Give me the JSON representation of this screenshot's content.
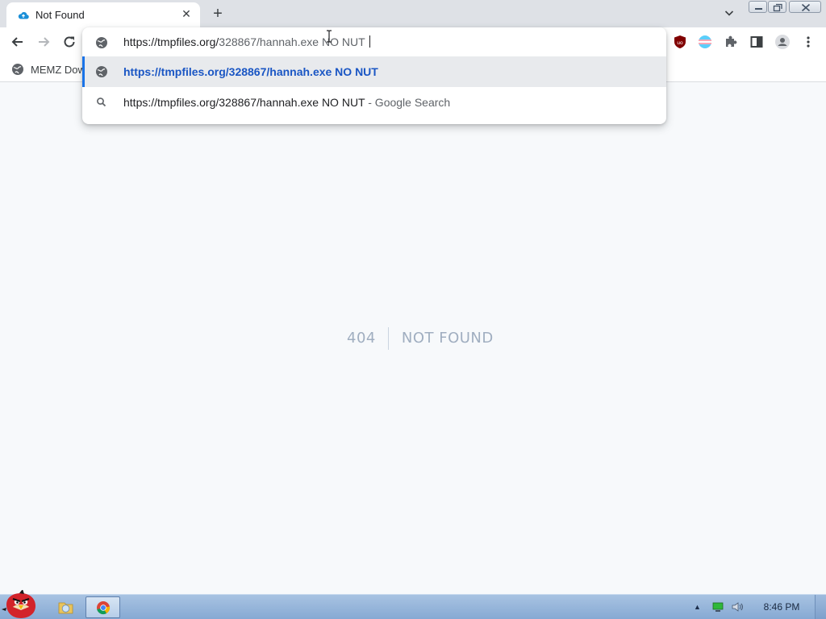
{
  "tab": {
    "title": "Not Found",
    "close_icon": "close-icon",
    "favicon": "cloud-favicon"
  },
  "toolbar": {
    "back_icon": "arrow-left-icon",
    "forward_icon": "arrow-right-icon",
    "reload_icon": "reload-icon"
  },
  "bookmarks": [
    {
      "label": "MEMZ Dow",
      "icon": "globe-icon"
    }
  ],
  "omnibox": {
    "input_host": "https://tmpfiles.org/",
    "input_path": "328867/hannah.exe NO NUT",
    "suggestions": [
      {
        "text": "https://tmpfiles.org/328867/hannah.exe NO NUT",
        "tail": "",
        "icon": "globe-icon",
        "selected": true
      },
      {
        "text": "https://tmpfiles.org/328867/hannah.exe NO NUT",
        "tail": " - Google Search",
        "icon": "search-icon",
        "selected": false
      }
    ]
  },
  "page": {
    "code": "404",
    "message": "NOT FOUND"
  },
  "taskbar": {
    "clock": "8:46 PM"
  },
  "colors": {
    "accent": "#1a73e8",
    "selected_text": "#1a56c4",
    "error_text": "#a0aec0",
    "page_bg": "#f7f9fb"
  }
}
